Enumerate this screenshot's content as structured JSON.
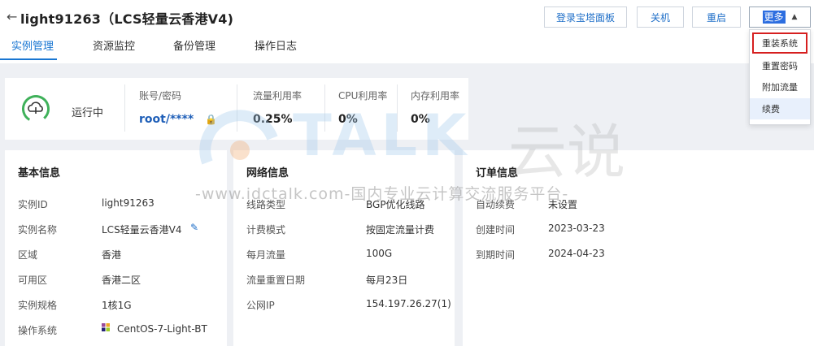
{
  "header": {
    "back_icon": "arrow-left-icon",
    "title": "light91263（LCS轻量云香港V4)"
  },
  "tabs": [
    {
      "label": "实例管理",
      "active": true
    },
    {
      "label": "资源监控",
      "active": false
    },
    {
      "label": "备份管理",
      "active": false
    },
    {
      "label": "操作日志",
      "active": false
    }
  ],
  "actions": {
    "panel_login": "登录宝塔面板",
    "shutdown": "关机",
    "restart": "重启",
    "more": "更多"
  },
  "more_menu": [
    {
      "label": "重装系统",
      "highlighted": true
    },
    {
      "label": "重置密码"
    },
    {
      "label": "附加流量"
    },
    {
      "label": "续费",
      "hovered": true
    }
  ],
  "status": {
    "state": "运行中",
    "account_label": "账号/密码",
    "account_value": "root/****",
    "traffic_label": "流量利用率",
    "traffic_value": "0.25%",
    "cpu_label": "CPU利用率",
    "cpu_value": "0%",
    "mem_label": "内存利用率",
    "mem_value": "0%"
  },
  "basic": {
    "title": "基本信息",
    "rows": [
      {
        "label": "实例ID",
        "value": "light91263"
      },
      {
        "label": "实例名称",
        "value": "LCS轻量云香港V4"
      },
      {
        "label": "区域",
        "value": "香港"
      },
      {
        "label": "可用区",
        "value": "香港二区"
      },
      {
        "label": "实例规格",
        "value": "1核1G"
      },
      {
        "label": "操作系统",
        "value": "CentOS-7-Light-BT"
      }
    ]
  },
  "network": {
    "title": "网络信息",
    "rows": [
      {
        "label": "线路类型",
        "value": "BGP优化线路"
      },
      {
        "label": "计费模式",
        "value": "按固定流量计费"
      },
      {
        "label": "每月流量",
        "value": "100G"
      },
      {
        "label": "流量重置日期",
        "value": "每月23日"
      },
      {
        "label": "公网IP",
        "value": "154.197.26.27(1)"
      }
    ]
  },
  "order": {
    "title": "订单信息",
    "rows": [
      {
        "label": "自动续费",
        "value": "未设置"
      },
      {
        "label": "创建时间",
        "value": "2023-03-23"
      },
      {
        "label": "到期时间",
        "value": "2024-04-23"
      }
    ]
  },
  "watermark": {
    "brand": "TALK",
    "brand_cn": "云说",
    "site": "-www.idctalk.com-国内专业云计算交流服务平台-"
  },
  "colors": {
    "accent": "#1976d2",
    "status_green": "#3fb15a",
    "highlight_red": "#d61f1f"
  }
}
